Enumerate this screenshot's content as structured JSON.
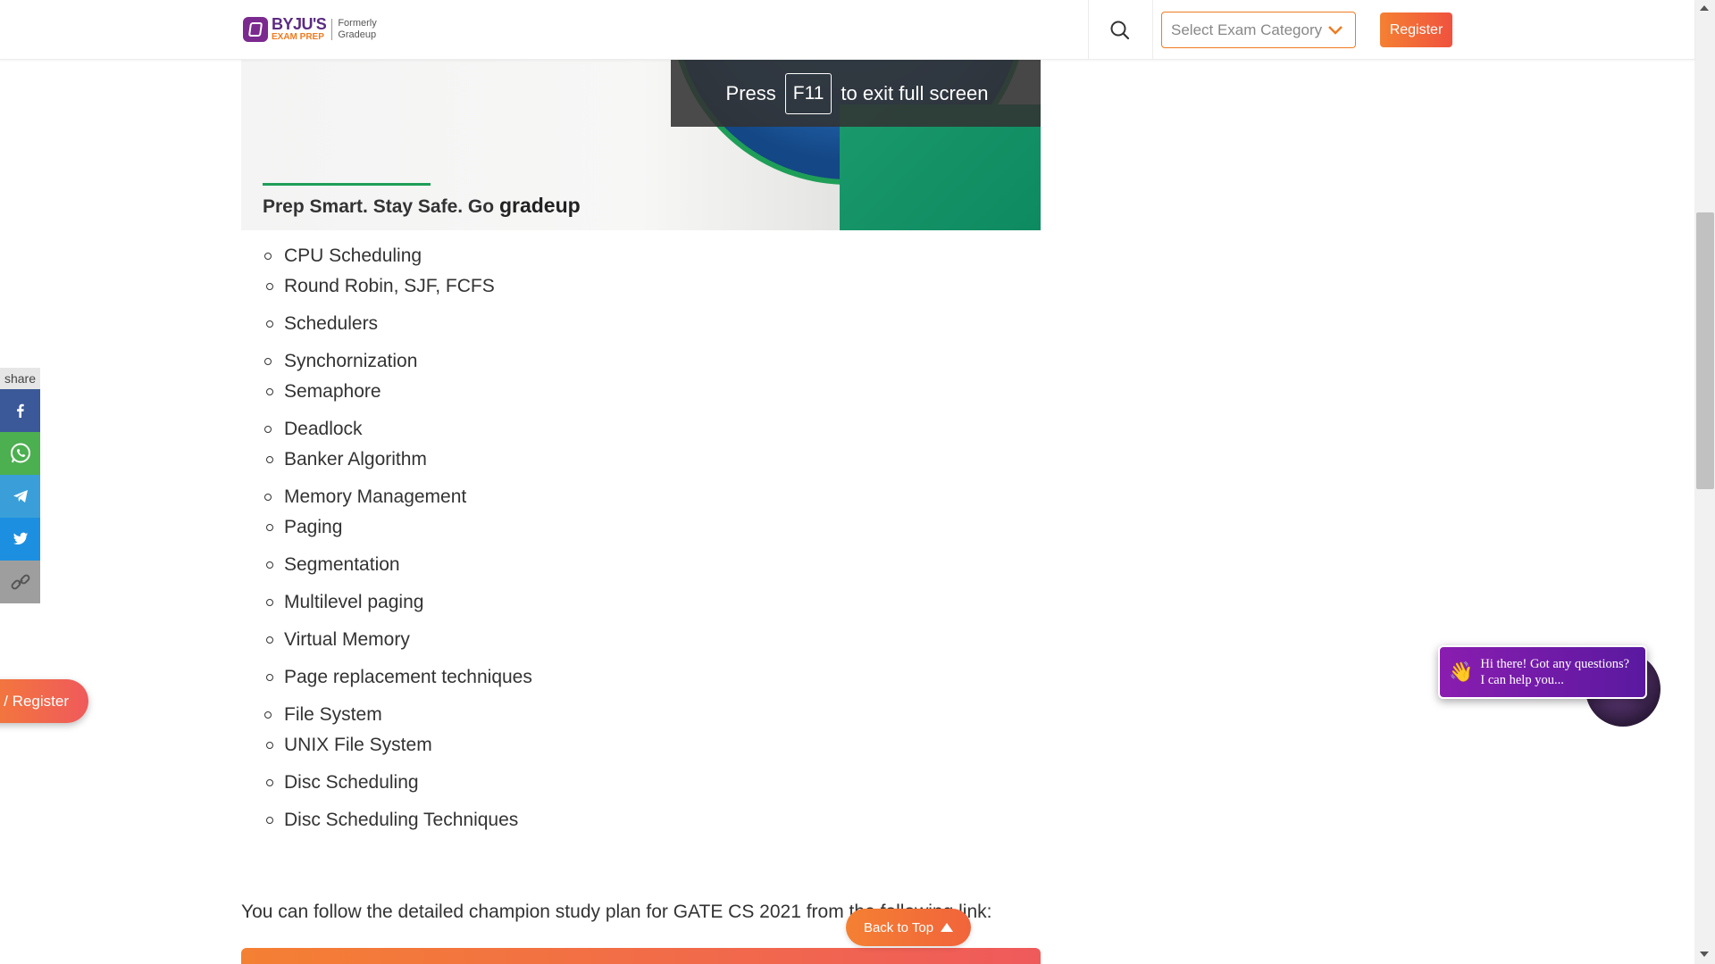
{
  "header": {
    "logo_brand": "BYJU'S",
    "logo_sub": "EXAM PREP",
    "logo_formerly_1": "Formerly",
    "logo_formerly_2": "Gradeup",
    "exam_select_placeholder": "Select Exam Category",
    "register_label": "Register"
  },
  "banner": {
    "fullscreen_press": "Press",
    "fullscreen_key": "F11",
    "fullscreen_rest": "to exit full screen",
    "tagline": "Prep Smart. Stay Safe. Go",
    "tagline_brand": "gradeup"
  },
  "topics": [
    {
      "label": "CPU Scheduling",
      "subs": [
        "Round Robin, SJF, FCFS",
        "Schedulers"
      ]
    },
    {
      "label": "Synchornization",
      "subs": [
        "Semaphore"
      ]
    },
    {
      "label": "Deadlock",
      "subs": [
        "Banker Algorithm"
      ]
    },
    {
      "label": "Memory Management",
      "subs": [
        "Paging",
        "Segmentation",
        "Multilevel paging",
        "Virtual Memory",
        "Page replacement techniques"
      ]
    },
    {
      "label": "File System",
      "subs": [
        "UNIX File System",
        "Disc Scheduling",
        "Disc Scheduling Techniques"
      ]
    }
  ],
  "champion_text": "You can follow the detailed champion study plan for GATE CS 2021 from the following link:",
  "share": {
    "label": "share",
    "colors": {
      "facebook": "#3b5998",
      "whatsapp": "#4caf50",
      "telegram": "#3a9fd8",
      "twitter": "#1d8fe0",
      "link": "#9e9e9e"
    }
  },
  "login_register_label": "/ Register",
  "back_to_top_label": "Back to Top",
  "chat": {
    "line1": "Hi there! Got any questions?",
    "line2": "I can help you..."
  },
  "colors": {
    "accent_orange": "#f07b20",
    "brand_purple": "#5b2b82",
    "banner_green": "#1a9a6c"
  }
}
